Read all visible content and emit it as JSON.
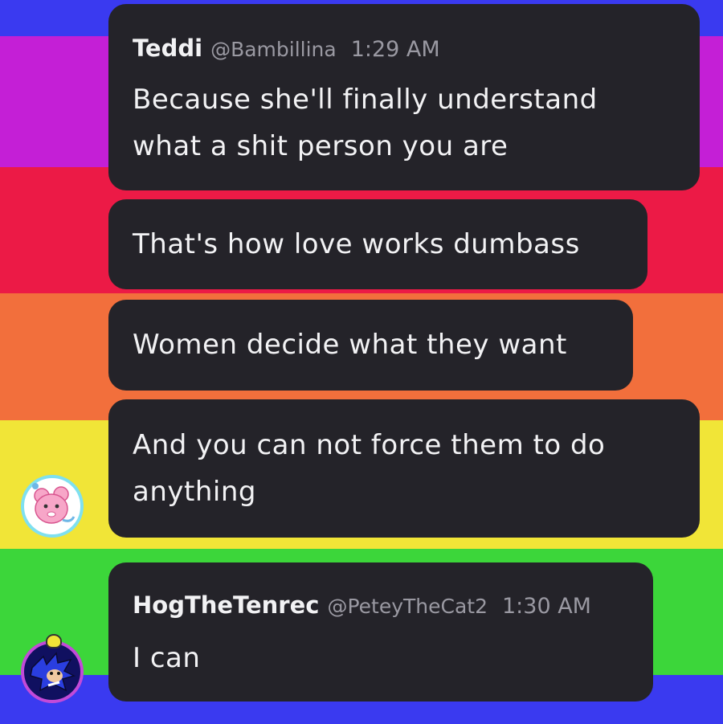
{
  "background": {
    "stripes": [
      "#3a3af0",
      "#c41fd6",
      "#ec1a46",
      "#f26f3c",
      "#f1e537",
      "#3cd63a",
      "#3a3af0"
    ]
  },
  "messages": [
    {
      "author": "Teddi",
      "handle": "@Bambillina",
      "time": "1:29 AM",
      "text": "Because she'll finally understand\nwhat a shit person you are"
    },
    {
      "text": "That's how love works dumbass"
    },
    {
      "text": "Women decide what they want"
    },
    {
      "text": "And you can not force them to do\nanything"
    },
    {
      "author": "HogTheTenrec",
      "handle": "@PeteyTheCat2",
      "time": "1:30 AM",
      "text": "I can"
    }
  ],
  "avatars": {
    "teddi": {
      "icon": "pink-bear-avatar-icon",
      "ring": "#7fe0f0"
    },
    "hog": {
      "icon": "blue-hedgehog-avatar-icon",
      "ring": "#c24ad8"
    }
  }
}
